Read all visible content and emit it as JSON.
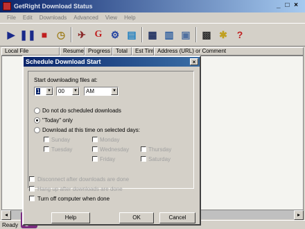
{
  "window": {
    "title": "GetRight Download Status",
    "controls": "_ □ ×"
  },
  "menu": [
    "File",
    "Edit",
    "Downloads",
    "Advanced",
    "View",
    "Help"
  ],
  "toolbar": {
    "icons": [
      "resume-icon",
      "pause-icon",
      "stop-icon",
      "schedule-icon",
      "getright-icon",
      "options-icon",
      "config-icon",
      "monitor-icon",
      "browse-icon",
      "calendar-icon",
      "help-icon"
    ]
  },
  "columns": [
    "Local File",
    "Resume",
    "Progress",
    "Total",
    "Est Time",
    "Address (URL) or Comment"
  ],
  "status": "Ready",
  "dialog": {
    "title": "Schedule Download Start",
    "close": "×",
    "start_label": "Start downloading files at:",
    "hour": "1",
    "minute": "00",
    "ampm": "AM",
    "options": [
      {
        "label": "Do not do scheduled downloads",
        "checked": false
      },
      {
        "label": "\"Today\" only",
        "checked": true
      },
      {
        "label": "Download at this time on selected days:",
        "checked": false
      }
    ],
    "days": [
      "Sunday",
      "Monday",
      "Tuesday",
      "Wednesday",
      "Thursday",
      "Friday",
      "Saturday"
    ],
    "extra_options": [
      "Disconnect after downloads are done",
      "Hang up after downloads are done",
      "Turn off computer when done"
    ],
    "buttons": {
      "help": "Help",
      "ok": "OK",
      "cancel": "Cancel"
    }
  }
}
